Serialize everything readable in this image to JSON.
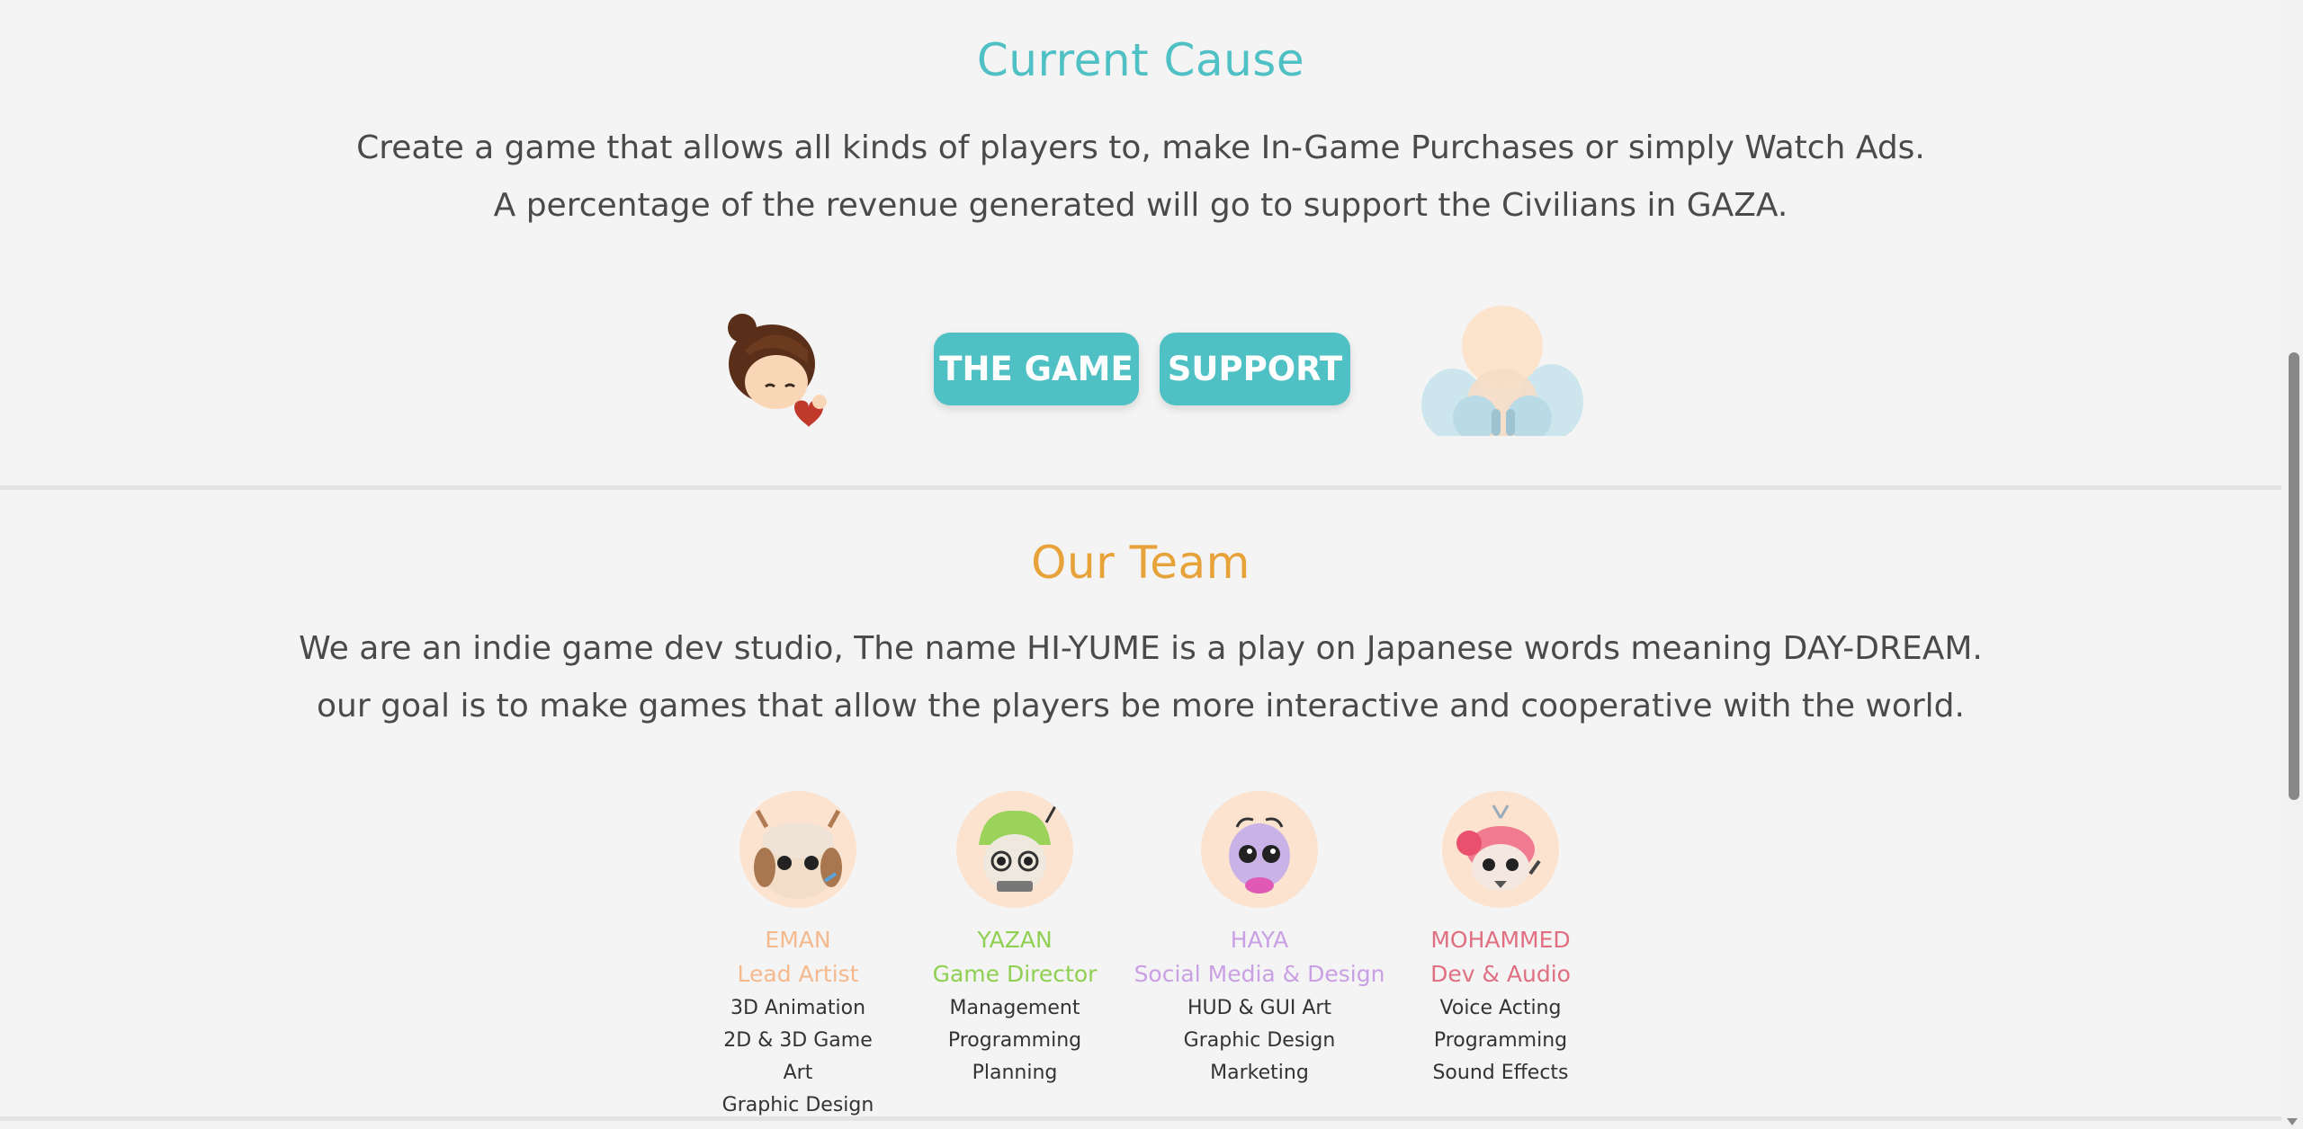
{
  "cause": {
    "title": "Current Cause",
    "line1": "Create a game that allows all kinds of players to, make In-Game Purchases or simply Watch Ads.",
    "line2": "A percentage of the revenue generated will go to support the Civilians in GAZA.",
    "game_button": "THE GAME",
    "support_button": "SUPPORT",
    "accent_color": "#4fc1c5"
  },
  "team": {
    "title": "Our Team",
    "line1": "We are an indie game dev studio, The name HI-YUME is a play on Japanese words meaning DAY-DREAM.",
    "line2": "our goal is to make games that allow the players be more interactive and cooperative with the world.",
    "accent_color": "#e7a23a",
    "members": [
      {
        "name": "EMAN",
        "role": "Lead Artist",
        "skills": [
          "3D Animation",
          "2D & 3D Game Art",
          "Graphic Design"
        ],
        "color": "#f5b98e",
        "icon": "deer-cat-avatar-icon"
      },
      {
        "name": "YAZAN",
        "role": "Game Director",
        "skills": [
          "Management",
          "Programming",
          "Planning"
        ],
        "color": "#8fcf52",
        "icon": "green-hair-avatar-icon"
      },
      {
        "name": "HAYA",
        "role": "Social Media & Design",
        "skills": [
          "HUD & GUI Art",
          "Graphic Design",
          "Marketing"
        ],
        "color": "#c9a0e4",
        "icon": "purple-bug-avatar-icon"
      },
      {
        "name": "MOHAMMED",
        "role": "Dev & Audio",
        "skills": [
          "Voice Acting",
          "Programming",
          "Sound Effects"
        ],
        "color": "#e06f82",
        "icon": "pink-bird-avatar-icon"
      }
    ]
  }
}
